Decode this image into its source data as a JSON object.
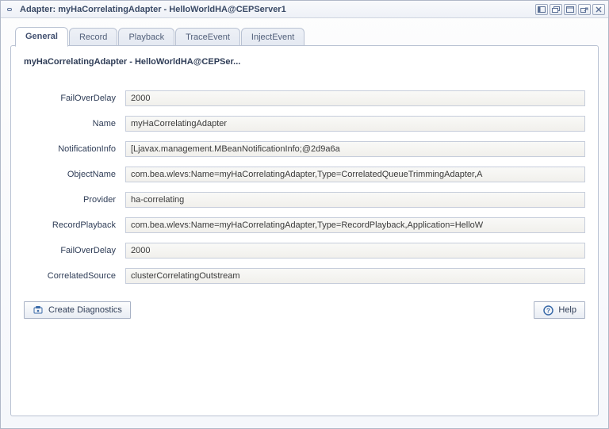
{
  "window": {
    "title": "Adapter: myHaCorrelatingAdapter - HelloWorldHA@CEPServer1"
  },
  "tabs": [
    {
      "label": "General",
      "active": true
    },
    {
      "label": "Record",
      "active": false
    },
    {
      "label": "Playback",
      "active": false
    },
    {
      "label": "TraceEvent",
      "active": false
    },
    {
      "label": "InjectEvent",
      "active": false
    }
  ],
  "panel": {
    "heading": "myHaCorrelatingAdapter - HelloWorldHA@CEPSer..."
  },
  "fields": [
    {
      "label": "FailOverDelay",
      "value": "2000"
    },
    {
      "label": "Name",
      "value": "myHaCorrelatingAdapter"
    },
    {
      "label": "NotificationInfo",
      "value": "[Ljavax.management.MBeanNotificationInfo;@2d9a6a"
    },
    {
      "label": "ObjectName",
      "value": "com.bea.wlevs:Name=myHaCorrelatingAdapter,Type=CorrelatedQueueTrimmingAdapter,A"
    },
    {
      "label": "Provider",
      "value": "ha-correlating"
    },
    {
      "label": "RecordPlayback",
      "value": "com.bea.wlevs:Name=myHaCorrelatingAdapter,Type=RecordPlayback,Application=HelloW"
    },
    {
      "label": "FailOverDelay",
      "value": "2000"
    },
    {
      "label": "CorrelatedSource",
      "value": "clusterCorrelatingOutstream"
    }
  ],
  "actions": {
    "create_diagnostics": "Create Diagnostics",
    "help": "Help"
  },
  "icons": {
    "title_icon": "link-icon",
    "tb1": "dock-left-icon",
    "tb2": "restore-icon",
    "tb3": "maximize-icon",
    "tb4": "detach-icon",
    "tb5": "close-icon"
  }
}
